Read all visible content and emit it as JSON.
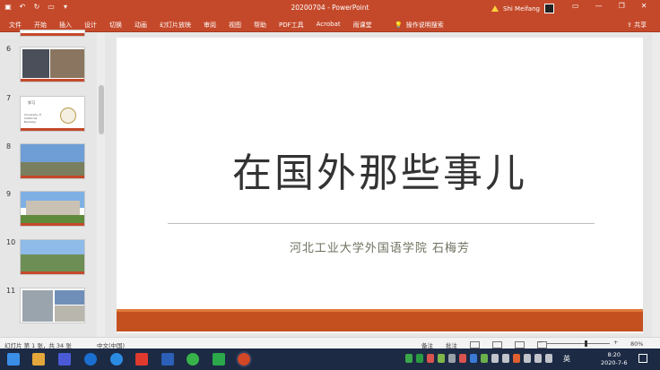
{
  "window": {
    "title": "20200704 - PowerPoint",
    "user": "Shi Meifang",
    "minimize_glyph": "—",
    "restore_glyph": "❐",
    "close_glyph": "✕"
  },
  "qat": [
    "save-icon",
    "undo-icon",
    "redo-icon",
    "present-icon",
    "customize-icon"
  ],
  "ribbon": {
    "tabs": [
      "文件",
      "开始",
      "插入",
      "设计",
      "切换",
      "动画",
      "幻灯片放映",
      "审阅",
      "视图",
      "帮助",
      "PDF工具",
      "Acrobat",
      "雨课堂"
    ],
    "tell_me": "操作说明搜索",
    "share": "共享"
  },
  "thumbnails": [
    {
      "num": "6",
      "label": ""
    },
    {
      "num": "7",
      "label": "学习",
      "sublabel": "University of California Berkeley"
    },
    {
      "num": "8",
      "label": ""
    },
    {
      "num": "9",
      "label": ""
    },
    {
      "num": "10",
      "label": ""
    },
    {
      "num": "11",
      "label": ""
    }
  ],
  "slide": {
    "title": "在国外那些事儿",
    "subtitle": "河北工业大学外国语学院 石梅芳"
  },
  "status": {
    "slide_info": "幻灯片 第 1 张，共 34 张",
    "language": "中文(中国)",
    "notes": "备注",
    "comments": "批注",
    "zoom": "80%"
  },
  "taskbar": {
    "ime": "英",
    "time": "8:20",
    "date": "2020-7-6"
  },
  "colors": {
    "accent": "#c4492a",
    "taskbar": "#1c2a44"
  }
}
